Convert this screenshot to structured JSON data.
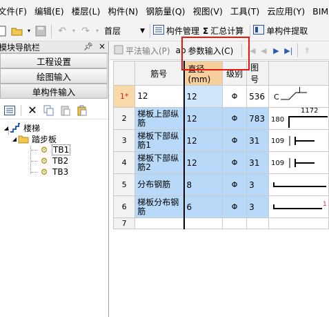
{
  "menu": [
    "文件(F)",
    "编辑(E)",
    "楼层(L)",
    "构件(N)",
    "钢筋量(Q)",
    "视图(V)",
    "工具(T)",
    "云应用(Y)",
    "BIM应用(I"
  ],
  "toolbar": {
    "floor_value": "首层",
    "component_manage": "构件管理",
    "summary_calc": "汇总计算",
    "single_extract": "单构件提取",
    "sigma": "Σ"
  },
  "left_panel": {
    "title": "模块导航栏",
    "pin": "ᵖ",
    "close": "×",
    "buttons": [
      "工程设置",
      "绘图输入",
      "单构件输入"
    ],
    "tree": {
      "root": "楼梯",
      "child": "踏步板",
      "leaves": [
        "TB1",
        "TB2",
        "TB3"
      ],
      "selected": "TB1"
    }
  },
  "right_tabs": {
    "flat_input": "平法输入(P)",
    "param_input": "参数输入(C)"
  },
  "grid": {
    "headers": [
      "筋号",
      "直径(mm)",
      "级别",
      "图号"
    ],
    "rows": [
      {
        "no": "1*",
        "name": "12",
        "diameter": "12",
        "grade": "Φ",
        "fig": "536",
        "sketch": "C⌐J⌐"
      },
      {
        "no": "2",
        "name": "梯板上部纵筋",
        "diameter": "12",
        "grade": "Φ",
        "fig": "783",
        "sketch_top": "1172",
        "sketch_left": "180"
      },
      {
        "no": "3",
        "name": "梯板下部纵筋1",
        "diameter": "12",
        "grade": "Φ",
        "fig": "31",
        "sketch_left": "109"
      },
      {
        "no": "4",
        "name": "梯板下部纵筋2",
        "diameter": "12",
        "grade": "Φ",
        "fig": "31",
        "sketch_left": "109"
      },
      {
        "no": "5",
        "name": "分布钢筋",
        "diameter": "8",
        "grade": "Φ",
        "fig": "3"
      },
      {
        "no": "6",
        "name": "梯板分布钢筋",
        "diameter": "6",
        "grade": "Φ",
        "fig": "3"
      },
      {
        "no": "7",
        "name": "",
        "diameter": "",
        "grade": "",
        "fig": ""
      }
    ]
  }
}
